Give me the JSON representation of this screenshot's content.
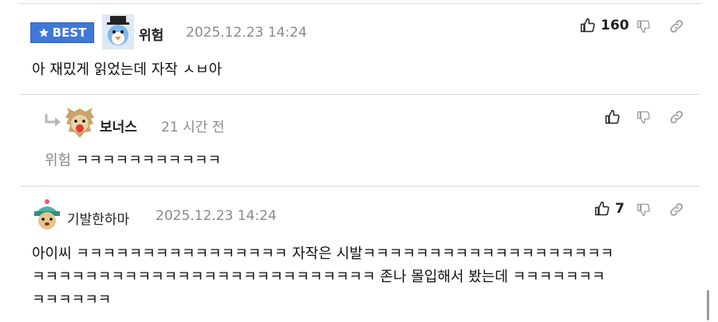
{
  "comments": [
    {
      "badge": "BEST",
      "nickname": "위험",
      "timestamp": "2025.12.23 14:24",
      "likes": "160",
      "text": "아 재밌게 읽었는데 자작 ㅅㅂ아"
    },
    {
      "nickname": "보너스",
      "timestamp": "21 시간 전",
      "likes": "",
      "mention": "위험",
      "text": "ㅋㅋㅋㅋㅋㅋㅋㅋㅋㅋㅋ"
    },
    {
      "nickname": "기발한하마",
      "timestamp": "2025.12.23 14:24",
      "likes": "7",
      "text_lines": [
        "아이씨 ㅋㅋㅋㅋㅋㅋㅋㅋㅋㅋㅋㅋㅋㅋㅋㅋ 자작은 시발ㅋㅋㅋㅋㅋㅋㅋㅋㅋㅋㅋㅋㅋㅋㅋㅋㅋㅋㅋ",
        "ㅋㅋㅋㅋㅋㅋㅋㅋㅋㅋㅋㅋㅋㅋㅋㅋㅋㅋㅋㅋㅋㅋㅋㅋㅋㅋ 존나 몰입해서 봤는데 ㅋㅋㅋㅋㅋㅋㅋ",
        "ㅋㅋㅋㅋㅋㅋ"
      ]
    }
  ],
  "icons": {
    "badge_icon": "star-icon",
    "like": "thumbs-up-icon",
    "dislike": "thumbs-down-icon",
    "link": "link-icon",
    "reply": "reply-arrow-icon"
  },
  "colors": {
    "badge_bg": "#3f78d8",
    "muted": "#8a8a8a",
    "divider": "#d9d9d9"
  }
}
